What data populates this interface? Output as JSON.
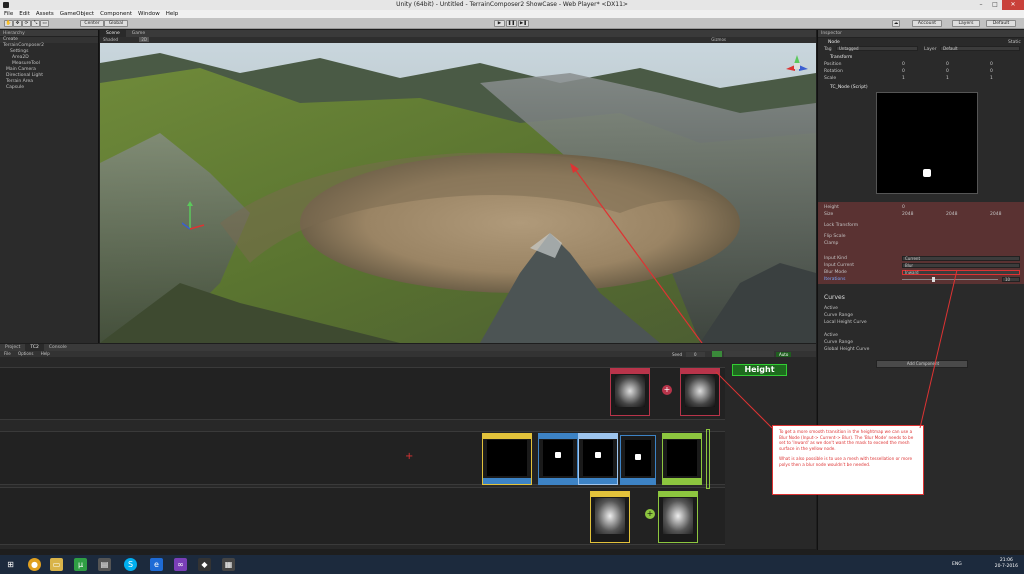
{
  "window": {
    "title": "Unity (64bit) - Untitled - TerrainComposer2 ShowCase - Web Player* <DX11>",
    "buttons": [
      "–",
      "□",
      "✕"
    ]
  },
  "menu": [
    "File",
    "Edit",
    "Assets",
    "GameObject",
    "Component",
    "Window",
    "Help"
  ],
  "toolbar": {
    "pivot": "Center",
    "space": "Global",
    "account": "Account",
    "layers": "Layers",
    "layout": "Default"
  },
  "hierarchy": {
    "tab": "Hierarchy",
    "create": "Create",
    "items": [
      "TerrainComposer2",
      "Settings",
      "Area2D",
      "MeasureTool",
      "Main Camera",
      "Directional Light",
      "Terrain Area",
      "Capsule"
    ]
  },
  "scene": {
    "tabs": [
      "Scene",
      "Game"
    ],
    "shading": "Shaded",
    "mode": "2D",
    "gizmos": "Gizmos"
  },
  "inspector": {
    "tab": "Inspector",
    "object_name": "Node",
    "static": "Static",
    "tag_label": "Tag",
    "tag": "Untagged",
    "layer_label": "Layer",
    "layer": "Default",
    "transform": {
      "title": "Transform",
      "rows": [
        {
          "label": "Position",
          "x": "0",
          "y": "0",
          "z": "0"
        },
        {
          "label": "Rotation",
          "x": "0",
          "y": "0",
          "z": "0"
        },
        {
          "label": "Scale",
          "x": "1",
          "y": "1",
          "z": "1"
        }
      ]
    },
    "script_title": "TC_Node (Script)",
    "fields": {
      "height_label": "Height",
      "height": "0",
      "size_label": "Size",
      "size_x": "2048",
      "size_y": "2048",
      "size_z": "2048",
      "lock_transform": "Lock Transform",
      "flip_scale": "Flip Scale",
      "clamp": "Clamp",
      "input_kind_label": "Input Kind",
      "input_kind": "Current",
      "input_current_label": "Input Current",
      "input_current": "Blur",
      "blur_mode_label": "Blur Mode",
      "blur_mode": "Inward",
      "iterations_label": "Iterations",
      "iterations": "10"
    },
    "curves": {
      "title": "Curves",
      "active1": "Active",
      "curve_range1": "Curve Range",
      "local_height_curve": "Local Height Curve",
      "active2": "Active",
      "curve_range2": "Curve Range",
      "global_height_curve": "Global Height Curve"
    },
    "add_component": "Add Component"
  },
  "bottom": {
    "tabs": [
      "Project",
      "TC2",
      "Console"
    ],
    "subtabs": [
      "File",
      "Options",
      "Help"
    ],
    "seed_label": "Seed",
    "seed": "0",
    "auto": "Auto",
    "height_node": "Height"
  },
  "callout": {
    "p1": "To get a more smooth transition in the heightmap we can use a Blur Node (Input-> Current-> Blur). The 'Blur Mode' needs to be set to 'Inward' as we don't want the mask to exceed the mesh surface in the yellow node.",
    "p2": "What is also possible is to use a mesh with tessellation or more polys then a blur node wouldn't be needed."
  },
  "taskbar": {
    "time": "21:06",
    "date": "20-7-2016",
    "lang": "ENG"
  },
  "colors": {
    "accent_red": "#d33333",
    "node_green": "#8dc63f",
    "node_blue": "#3d83c5",
    "node_yellow": "#e2c23b",
    "node_red": "#b8344a"
  }
}
